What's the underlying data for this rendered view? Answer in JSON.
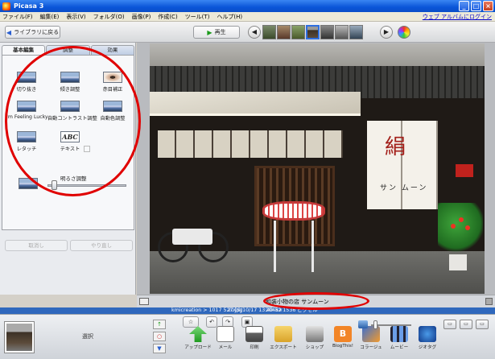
{
  "window": {
    "title": "Picasa 3",
    "controls": [
      "_",
      "□",
      "×"
    ]
  },
  "menu": {
    "items": [
      "ファイル(F)",
      "編集(E)",
      "表示(V)",
      "フォルダ(O)",
      "画像(P)",
      "作成(C)",
      "ツール(T)",
      "ヘルプ(H)"
    ],
    "web_album_link": "ウェブ アルバムにログイン"
  },
  "toolbar": {
    "back_label": "ライブラリに戻る",
    "back_icon": "◀",
    "play_label": "再生",
    "play_icon": "▶",
    "prev": "◀",
    "next": "▶"
  },
  "left_panel": {
    "tabs": [
      "基本編集",
      "調整",
      "効果"
    ],
    "tools": [
      {
        "label": "切り抜き"
      },
      {
        "label": "傾き調整"
      },
      {
        "label": "赤目補正"
      },
      {
        "label": "I'm Feeling Lucky"
      },
      {
        "label": "自動コントラスト調整"
      },
      {
        "label": "自動色調整"
      },
      {
        "label": "レタッチ"
      },
      {
        "label": "テキスト"
      }
    ],
    "text_tool_glyph": "ABC",
    "brightness_label": "明るさ調整",
    "brightness_value": 0.05,
    "undo_label": "取消し",
    "redo_label": "やり直し"
  },
  "photo": {
    "noren_mark": "絹",
    "noren_text": "サン ムーン"
  },
  "caption": {
    "text": "和装小物の店 サンムーン"
  },
  "status": {
    "path": "kmicreation > 1017 527.jpg",
    "date": "2009/10/17 13:40:52",
    "dims": "2048×1536 ピクセル"
  },
  "tray": {
    "selected_label": "選択",
    "side_buttons": [
      "↑",
      "○",
      "▼"
    ],
    "actions": [
      {
        "label": "アップロード"
      },
      {
        "label": "メール"
      },
      {
        "label": "印刷"
      },
      {
        "label": "エクスポート"
      },
      {
        "label": "ショップ"
      },
      {
        "label": "BlogThis!"
      },
      {
        "label": "コラージュ"
      },
      {
        "label": "ムービー"
      },
      {
        "label": "ジオタグ"
      }
    ],
    "blog_glyph": "B",
    "zoom_value": 0.05,
    "view_buttons": [
      "▭",
      "▭",
      "▭"
    ]
  },
  "colors": {
    "title_bar": "#0a55d8",
    "status_bar": "#2f68bd",
    "annotation": "#e00000"
  }
}
